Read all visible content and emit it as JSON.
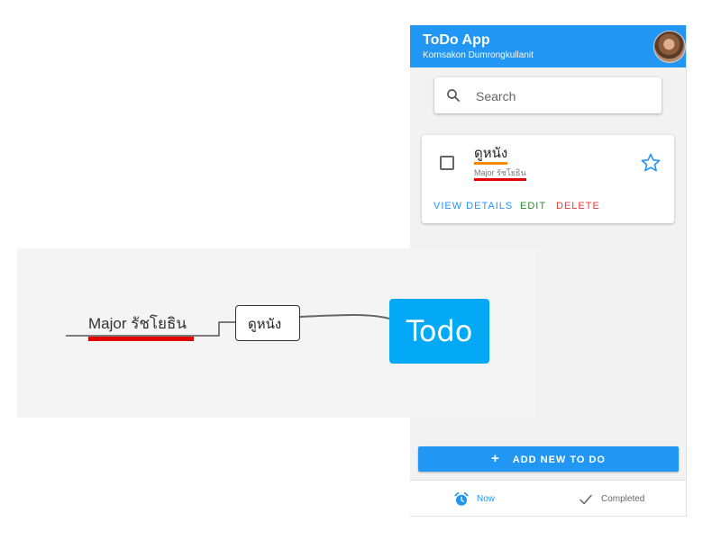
{
  "app": {
    "title": "ToDo App",
    "subtitle": "Kornsakon Dumrongkullanit",
    "accent_color": "#2196f3"
  },
  "search": {
    "placeholder": "Search"
  },
  "todo_item": {
    "title": "ดูหนัง",
    "subtitle": "Major รัชโยธิน",
    "checked": false,
    "starred": false,
    "actions": {
      "view": "VIEW DETAILS",
      "edit": "EDIT",
      "delete": "DELETE"
    }
  },
  "add_button": {
    "icon": "plus-icon",
    "label": "ADD NEW TO DO"
  },
  "bottom_nav": {
    "now": {
      "icon": "alarm-clock-icon",
      "label": "Now",
      "active": true
    },
    "completed": {
      "icon": "check-icon",
      "label": "Completed",
      "active": false
    }
  },
  "mindmap": {
    "root": "Todo",
    "child": "ดูหนัง",
    "grandchild": "Major รัชโยธิน",
    "colors": {
      "root": "#03a9f4",
      "child_underline": "#f28a00",
      "grandchild_underline": "#e00000"
    }
  }
}
